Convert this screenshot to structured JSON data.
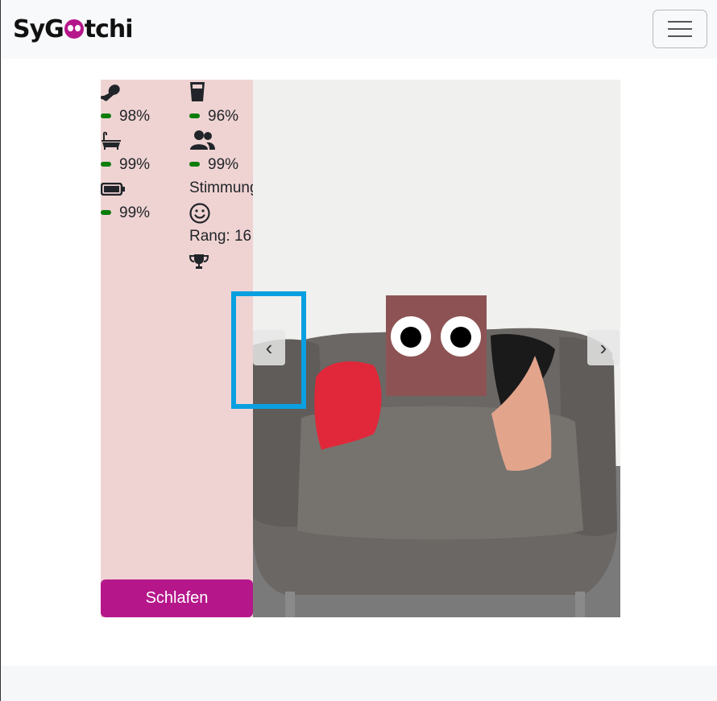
{
  "navbar": {
    "brand_prefix": "SyG",
    "brand_suffix": "tchi",
    "menu_button_label": "Toggle navigation"
  },
  "stats": {
    "hunger": {
      "icon": "drumstick-icon",
      "percent": "98%",
      "level": 0.98
    },
    "thirst": {
      "icon": "glass-icon",
      "percent": "96%",
      "level": 0.96
    },
    "hygiene": {
      "icon": "bathtub-icon",
      "percent": "99%",
      "level": 0.99
    },
    "social": {
      "icon": "users-icon",
      "percent": "99%",
      "level": 0.99
    },
    "energy": {
      "icon": "battery-icon",
      "percent": "99%",
      "level": 0.99
    },
    "mood_label": "Stimmung",
    "mood_icon": "smiley-icon",
    "rank_label": "Rang: 16",
    "rank_icon": "trophy-icon"
  },
  "actions": {
    "sleep_label": "Schlafen"
  },
  "carousel": {
    "prev_label": "‹",
    "next_label": "›"
  },
  "colors": {
    "brand": "#b5178b",
    "panel": "#efd3d3",
    "status_bar": "#0a7d0a",
    "pet_body": "#8d5354",
    "highlight": "#0aa0e0"
  }
}
